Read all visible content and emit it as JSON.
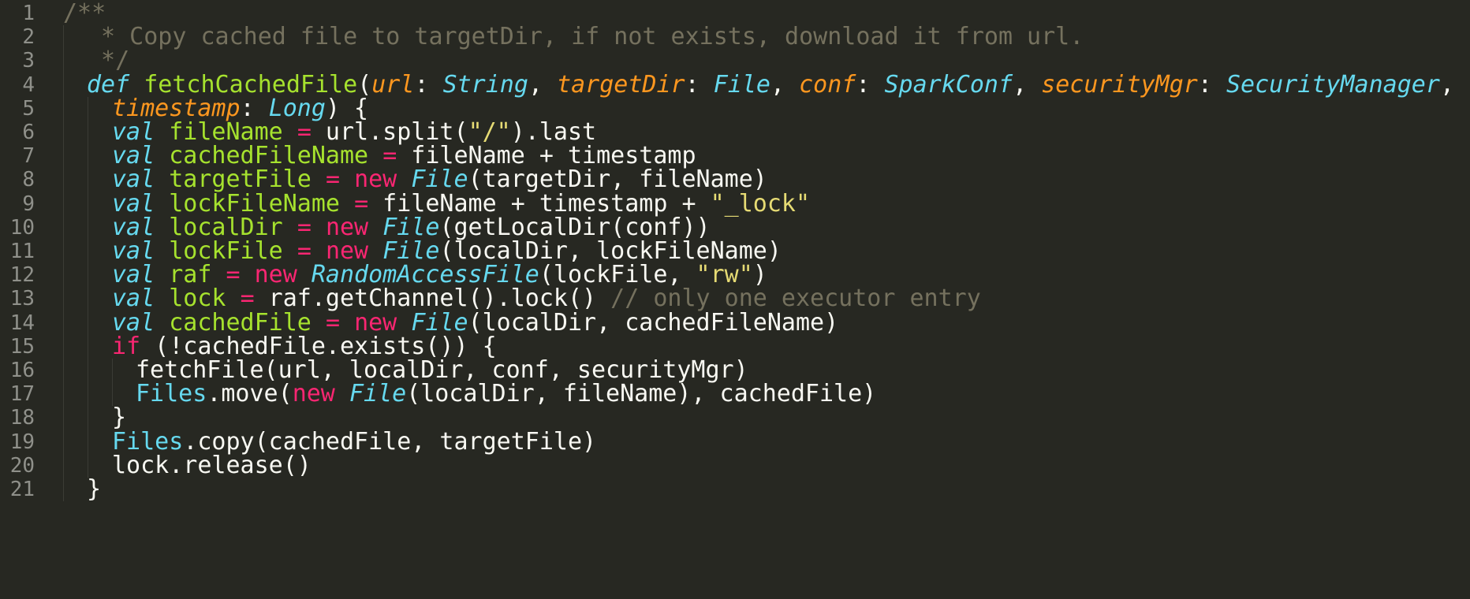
{
  "colors": {
    "background": "#272822",
    "line_number": "#8F908A",
    "comment": "#75715E",
    "keyword_storage": "#66D9EF",
    "function_name": "#A6E22E",
    "parameter": "#FD971F",
    "type": "#66D9EF",
    "keyword_flow": "#F92672",
    "variable": "#A6E22E",
    "string": "#E6DB74",
    "plain": "#F8F8F2"
  },
  "lines": [
    {
      "number": "1",
      "indent": 0,
      "tokens": [
        {
          "t": "comment",
          "v": "/**"
        }
      ]
    },
    {
      "number": "2",
      "indent": 1,
      "tokens": [
        {
          "t": "comment",
          "v": " * Copy cached file to targetDir, if not exists, download it from url."
        }
      ]
    },
    {
      "number": "3",
      "indent": 1,
      "tokens": [
        {
          "t": "comment",
          "v": " */"
        }
      ]
    },
    {
      "number": "4",
      "indent": 1,
      "tokens": [
        {
          "t": "keyword-def",
          "v": "def"
        },
        {
          "t": "plain",
          "v": " "
        },
        {
          "t": "function",
          "v": "fetchCachedFile"
        },
        {
          "t": "plain",
          "v": "("
        },
        {
          "t": "param",
          "v": "url"
        },
        {
          "t": "plain",
          "v": ": "
        },
        {
          "t": "type",
          "v": "String"
        },
        {
          "t": "plain",
          "v": ", "
        },
        {
          "t": "param",
          "v": "targetDir"
        },
        {
          "t": "plain",
          "v": ": "
        },
        {
          "t": "type",
          "v": "File"
        },
        {
          "t": "plain",
          "v": ", "
        },
        {
          "t": "param",
          "v": "conf"
        },
        {
          "t": "plain",
          "v": ": "
        },
        {
          "t": "type",
          "v": "SparkConf"
        },
        {
          "t": "plain",
          "v": ", "
        },
        {
          "t": "param",
          "v": "securityMgr"
        },
        {
          "t": "plain",
          "v": ": "
        },
        {
          "t": "type",
          "v": "SecurityManager"
        },
        {
          "t": "plain",
          "v": ","
        }
      ]
    },
    {
      "number": "5",
      "indent": 2,
      "tokens": [
        {
          "t": "param",
          "v": "timestamp"
        },
        {
          "t": "plain",
          "v": ": "
        },
        {
          "t": "type",
          "v": "Long"
        },
        {
          "t": "plain",
          "v": ") {"
        }
      ]
    },
    {
      "number": "6",
      "indent": 2,
      "tokens": [
        {
          "t": "type",
          "v": "val"
        },
        {
          "t": "plain",
          "v": " "
        },
        {
          "t": "var",
          "v": "fileName"
        },
        {
          "t": "plain",
          "v": " "
        },
        {
          "t": "keyword",
          "v": "="
        },
        {
          "t": "plain",
          "v": " url.split("
        },
        {
          "t": "string",
          "v": "\"/\""
        },
        {
          "t": "plain",
          "v": ").last"
        }
      ]
    },
    {
      "number": "7",
      "indent": 2,
      "tokens": [
        {
          "t": "type",
          "v": "val"
        },
        {
          "t": "plain",
          "v": " "
        },
        {
          "t": "var",
          "v": "cachedFileName"
        },
        {
          "t": "plain",
          "v": " "
        },
        {
          "t": "keyword",
          "v": "="
        },
        {
          "t": "plain",
          "v": " fileName + timestamp"
        }
      ]
    },
    {
      "number": "8",
      "indent": 2,
      "tokens": [
        {
          "t": "type",
          "v": "val"
        },
        {
          "t": "plain",
          "v": " "
        },
        {
          "t": "var",
          "v": "targetFile"
        },
        {
          "t": "plain",
          "v": " "
        },
        {
          "t": "keyword",
          "v": "="
        },
        {
          "t": "plain",
          "v": " "
        },
        {
          "t": "keyword",
          "v": "new"
        },
        {
          "t": "plain",
          "v": " "
        },
        {
          "t": "type",
          "v": "File"
        },
        {
          "t": "plain",
          "v": "(targetDir, fileName)"
        }
      ]
    },
    {
      "number": "9",
      "indent": 2,
      "tokens": [
        {
          "t": "type",
          "v": "val"
        },
        {
          "t": "plain",
          "v": " "
        },
        {
          "t": "var",
          "v": "lockFileName"
        },
        {
          "t": "plain",
          "v": " "
        },
        {
          "t": "keyword",
          "v": "="
        },
        {
          "t": "plain",
          "v": " fileName + timestamp + "
        },
        {
          "t": "string",
          "v": "\"_lock\""
        }
      ]
    },
    {
      "number": "10",
      "indent": 2,
      "tokens": [
        {
          "t": "type",
          "v": "val"
        },
        {
          "t": "plain",
          "v": " "
        },
        {
          "t": "var",
          "v": "localDir"
        },
        {
          "t": "plain",
          "v": " "
        },
        {
          "t": "keyword",
          "v": "="
        },
        {
          "t": "plain",
          "v": " "
        },
        {
          "t": "keyword",
          "v": "new"
        },
        {
          "t": "plain",
          "v": " "
        },
        {
          "t": "type",
          "v": "File"
        },
        {
          "t": "plain",
          "v": "(getLocalDir(conf))"
        }
      ]
    },
    {
      "number": "11",
      "indent": 2,
      "tokens": [
        {
          "t": "type",
          "v": "val"
        },
        {
          "t": "plain",
          "v": " "
        },
        {
          "t": "var",
          "v": "lockFile"
        },
        {
          "t": "plain",
          "v": " "
        },
        {
          "t": "keyword",
          "v": "="
        },
        {
          "t": "plain",
          "v": " "
        },
        {
          "t": "keyword",
          "v": "new"
        },
        {
          "t": "plain",
          "v": " "
        },
        {
          "t": "type",
          "v": "File"
        },
        {
          "t": "plain",
          "v": "(localDir, lockFileName)"
        }
      ]
    },
    {
      "number": "12",
      "indent": 2,
      "tokens": [
        {
          "t": "type",
          "v": "val"
        },
        {
          "t": "plain",
          "v": " "
        },
        {
          "t": "var",
          "v": "raf"
        },
        {
          "t": "plain",
          "v": " "
        },
        {
          "t": "keyword",
          "v": "="
        },
        {
          "t": "plain",
          "v": " "
        },
        {
          "t": "keyword",
          "v": "new"
        },
        {
          "t": "plain",
          "v": " "
        },
        {
          "t": "type",
          "v": "RandomAccessFile"
        },
        {
          "t": "plain",
          "v": "(lockFile, "
        },
        {
          "t": "string",
          "v": "\"rw\""
        },
        {
          "t": "plain",
          "v": ")"
        }
      ]
    },
    {
      "number": "13",
      "indent": 2,
      "tokens": [
        {
          "t": "type",
          "v": "val"
        },
        {
          "t": "plain",
          "v": " "
        },
        {
          "t": "var",
          "v": "lock"
        },
        {
          "t": "plain",
          "v": " "
        },
        {
          "t": "keyword",
          "v": "="
        },
        {
          "t": "plain",
          "v": " raf.getChannel().lock() "
        },
        {
          "t": "comment",
          "v": "// only one executor entry"
        }
      ]
    },
    {
      "number": "14",
      "indent": 2,
      "tokens": [
        {
          "t": "type",
          "v": "val"
        },
        {
          "t": "plain",
          "v": " "
        },
        {
          "t": "var",
          "v": "cachedFile"
        },
        {
          "t": "plain",
          "v": " "
        },
        {
          "t": "keyword",
          "v": "="
        },
        {
          "t": "plain",
          "v": " "
        },
        {
          "t": "keyword",
          "v": "new"
        },
        {
          "t": "plain",
          "v": " "
        },
        {
          "t": "type",
          "v": "File"
        },
        {
          "t": "plain",
          "v": "(localDir, cachedFileName)"
        }
      ]
    },
    {
      "number": "15",
      "indent": 2,
      "tokens": [
        {
          "t": "keyword",
          "v": "if"
        },
        {
          "t": "plain",
          "v": " (!cachedFile.exists()) {"
        }
      ]
    },
    {
      "number": "16",
      "indent": 3,
      "tokens": [
        {
          "t": "plain",
          "v": "fetchFile(url, localDir, conf, securityMgr)"
        }
      ]
    },
    {
      "number": "17",
      "indent": 3,
      "tokens": [
        {
          "t": "builtin",
          "v": "Files"
        },
        {
          "t": "plain",
          "v": ".move("
        },
        {
          "t": "keyword",
          "v": "new"
        },
        {
          "t": "plain",
          "v": " "
        },
        {
          "t": "type",
          "v": "File"
        },
        {
          "t": "plain",
          "v": "(localDir, fileName), cachedFile)"
        }
      ]
    },
    {
      "number": "18",
      "indent": 2,
      "tokens": [
        {
          "t": "plain",
          "v": "}"
        }
      ]
    },
    {
      "number": "19",
      "indent": 2,
      "tokens": [
        {
          "t": "builtin",
          "v": "Files"
        },
        {
          "t": "plain",
          "v": ".copy(cachedFile, targetFile)"
        }
      ]
    },
    {
      "number": "20",
      "indent": 2,
      "tokens": [
        {
          "t": "plain",
          "v": "lock.release()"
        }
      ]
    },
    {
      "number": "21",
      "indent": 1,
      "tokens": [
        {
          "t": "plain",
          "v": "}"
        }
      ]
    }
  ]
}
